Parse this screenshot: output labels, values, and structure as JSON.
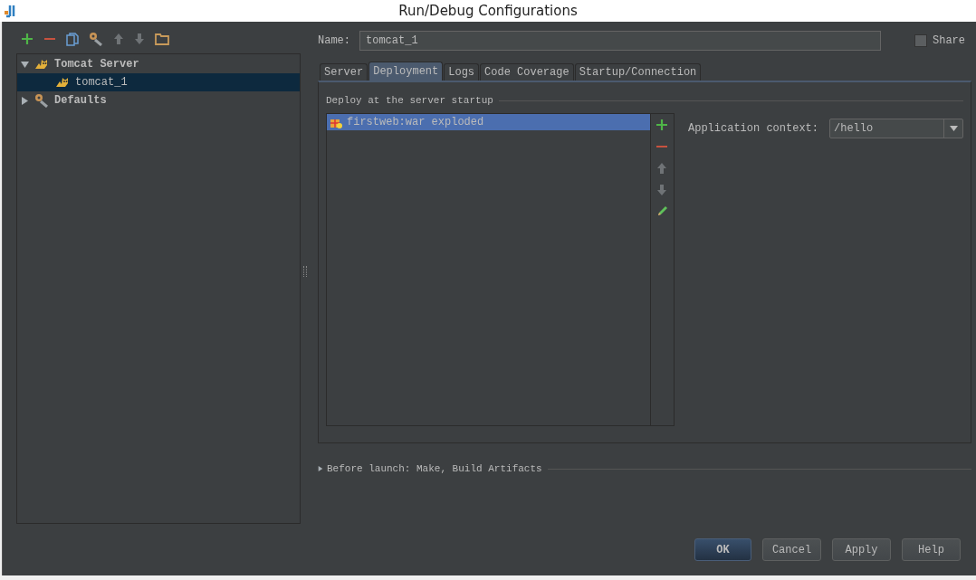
{
  "window": {
    "title": "Run/Debug Configurations"
  },
  "tree": [
    {
      "label": "Tomcat Server",
      "expanded": true,
      "selected": false,
      "kind": "server",
      "children": [
        {
          "label": "tomcat_1",
          "selected": true,
          "kind": "server"
        }
      ]
    },
    {
      "label": "Defaults",
      "expanded": false,
      "selected": false,
      "kind": "defaults"
    }
  ],
  "name_field": {
    "label": "Name:",
    "value": "tomcat_1"
  },
  "share": {
    "label": "Share",
    "checked": false
  },
  "tabs": [
    {
      "label": "Server",
      "selected": false
    },
    {
      "label": "Deployment",
      "selected": true
    },
    {
      "label": "Logs",
      "selected": false
    },
    {
      "label": "Code Coverage",
      "selected": false
    },
    {
      "label": "Startup/Connection",
      "selected": false
    }
  ],
  "deployment": {
    "group_title": "Deploy at the server startup",
    "artifacts": [
      {
        "label": "firstweb:war exploded",
        "selected": true
      }
    ],
    "context_label": "Application context:",
    "context_value": "/hello"
  },
  "before_launch": {
    "label": "Before launch: Make, Build Artifacts",
    "expanded": false
  },
  "buttons": [
    {
      "label": "OK",
      "default": true
    },
    {
      "label": "Cancel",
      "default": false
    },
    {
      "label": "Apply",
      "default": false
    },
    {
      "label": "Help",
      "default": false
    }
  ]
}
